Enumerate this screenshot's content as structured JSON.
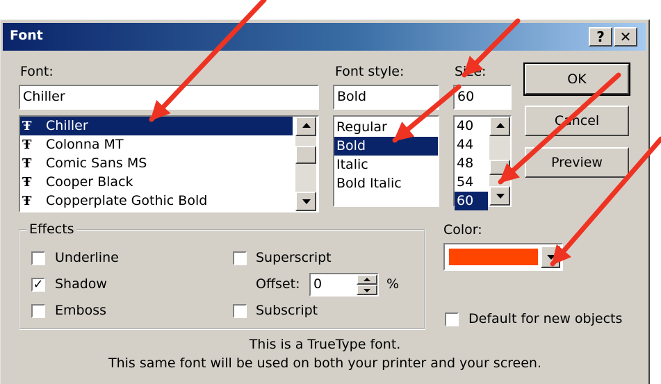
{
  "dialog": {
    "title": "Font",
    "help_label": "?",
    "close_label": "✕"
  },
  "font": {
    "label": "Font:",
    "value": "Chiller",
    "items": [
      "Chiller",
      "Colonna MT",
      "Comic Sans MS",
      "Cooper Black",
      "Copperplate Gothic Bold"
    ],
    "selected_index": 0,
    "item_icon": "truetype-icon"
  },
  "style": {
    "label": "Font style:",
    "value": "Bold",
    "items": [
      "Regular",
      "Bold",
      "Italic",
      "Bold Italic"
    ],
    "selected_index": 1
  },
  "size": {
    "label": "Size:",
    "value": "60",
    "items": [
      "40",
      "44",
      "48",
      "54",
      "60"
    ],
    "selected_index": 4
  },
  "buttons": {
    "ok": "OK",
    "cancel": "Cancel",
    "preview": "Preview"
  },
  "effects": {
    "legend": "Effects",
    "underline": "Underline",
    "underline_checked": false,
    "shadow": "Shadow",
    "shadow_checked": true,
    "emboss": "Emboss",
    "emboss_checked": false,
    "superscript": "Superscript",
    "superscript_checked": false,
    "offset_label": "Offset:",
    "offset_value": "0",
    "offset_unit": "%",
    "subscript": "Subscript",
    "subscript_checked": false
  },
  "color": {
    "label": "Color:",
    "value": "#ff4500"
  },
  "default_for_new": {
    "label": "Default for new objects",
    "checked": false
  },
  "info": {
    "line1": "This is a TrueType font.",
    "line2": "This same font will be used on both your printer and your screen."
  },
  "annotation_color": "#ee3322"
}
